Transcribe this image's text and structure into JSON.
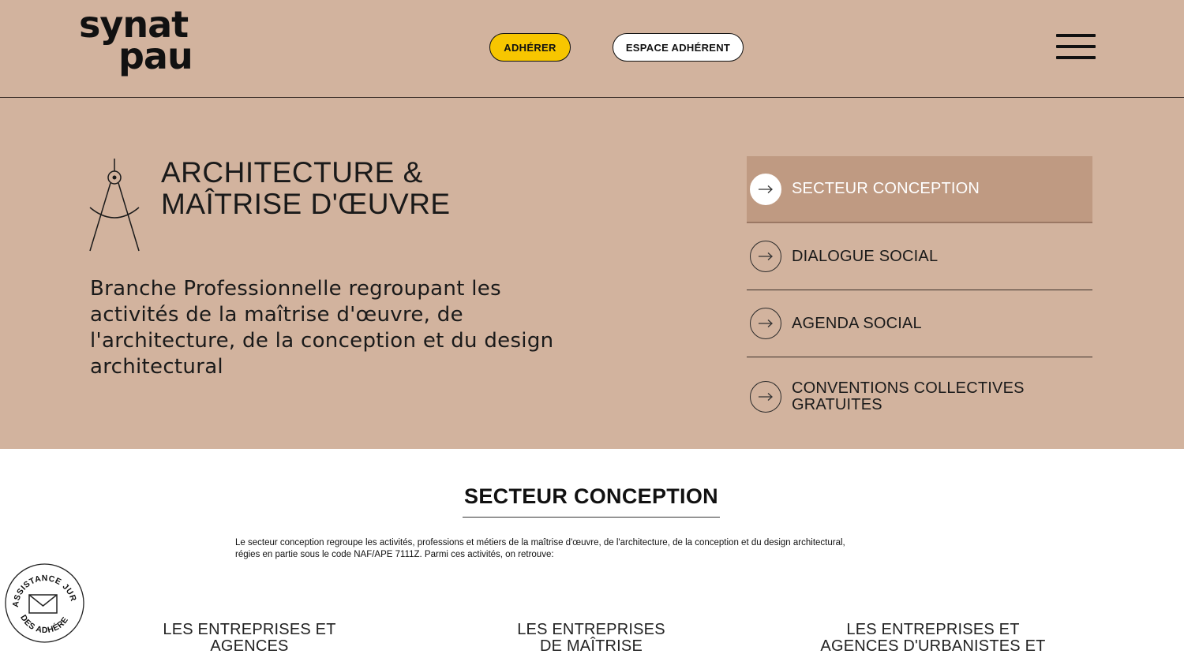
{
  "header": {
    "logo_line1": "synat",
    "logo_line2": "pau",
    "join_label": "ADHÉRER",
    "member_label": "ESPACE ADHÉRENT"
  },
  "hero": {
    "title_line1": "ARCHITECTURE &",
    "title_line2": "MAÎTRISE D'ŒUVRE",
    "description": "Branche Professionnelle regroupant les activités de la maîtrise d'œuvre, de l'architecture, de la conception et du design architectural"
  },
  "menu": {
    "items": [
      {
        "line1": "SECTEUR CONCEPTION",
        "line2": ""
      },
      {
        "line1": "DIALOGUE SOCIAL",
        "line2": ""
      },
      {
        "line1": "AGENDA SOCIAL",
        "line2": ""
      },
      {
        "line1": "CONVENTIONS COLLECTIVES",
        "line2": "GRATUITES"
      }
    ],
    "active_index": 0
  },
  "section": {
    "title": "SECTEUR CONCEPTION",
    "text_line1": "Le secteur conception regroupe les activités, professions et métiers de la maîtrise d'œuvre, de l'architecture, de la conception et du design architectural,",
    "text_line2": "régies en partie sous le code NAF/APE 7111Z. Parmi ces activités, on retrouve:"
  },
  "columns": [
    {
      "line1": "LES ENTREPRISES ET",
      "line2": "AGENCES"
    },
    {
      "line1": "LES ENTREPRISES",
      "line2": "DE MAÎTRISE"
    },
    {
      "line1": "LES ENTREPRISES ET",
      "line2": "AGENCES D'URBANISTES ET"
    }
  ],
  "badge": {
    "top_text": "ASSISTANCE JURIDIQUE",
    "bottom_text": "DES ADHÉRENTS",
    "icon": "mail-icon"
  },
  "colors": {
    "hero_bg": "#d2b39e",
    "active_item_bg": "#bf9a82",
    "join_button": "#f7c600"
  }
}
